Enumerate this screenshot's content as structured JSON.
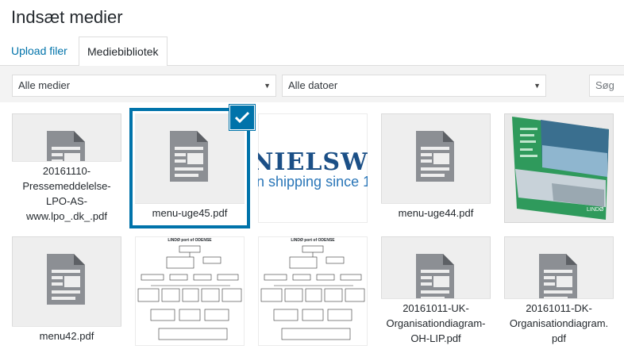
{
  "header": {
    "title": "Indsæt medier"
  },
  "tabs": {
    "upload": "Upload filer",
    "library": "Mediebibliotek"
  },
  "filters": {
    "type": "Alle medier",
    "date": "Alle datoer",
    "search_placeholder": "Søg"
  },
  "items": [
    {
      "caption": "20161110-Pressemeddelelse-LPO-AS-www.lpo_.dk_.pdf",
      "kind": "document"
    },
    {
      "caption": "menu-uge45.pdf",
      "kind": "document",
      "selected": true
    },
    {
      "caption": "",
      "kind": "image",
      "logo": "NIELSWIN",
      "logo_sub": "n shipping since 1"
    },
    {
      "caption": "menu-uge44.pdf",
      "kind": "document"
    },
    {
      "caption": "",
      "kind": "image",
      "brand": "LINDØ"
    },
    {
      "caption": "menu42.pdf",
      "kind": "document"
    },
    {
      "caption": "",
      "kind": "image",
      "heading": "LINDØ port of ODENSE"
    },
    {
      "caption": "",
      "kind": "image",
      "heading": "LINDØ port of ODENSE"
    },
    {
      "caption": "20161011-UK-Organisationdiagram-OH-LIP.pdf",
      "kind": "document"
    },
    {
      "caption": "20161011-DK-Organisationdiagram.pdf",
      "kind": "document"
    }
  ]
}
